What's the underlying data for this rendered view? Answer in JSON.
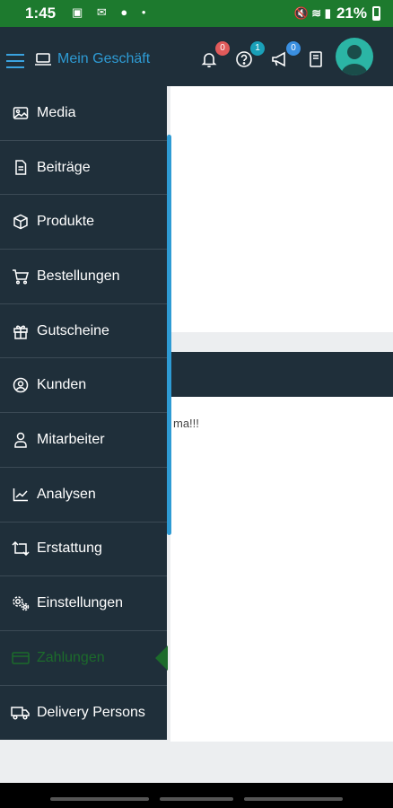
{
  "status_bar": {
    "time": "1:45",
    "battery": "21%"
  },
  "header": {
    "brand_label": "Mein Geschäft",
    "notifications_count": "0",
    "help_count": "1",
    "announcements_count": "0"
  },
  "background": {
    "text": "ma!!!"
  },
  "sidebar": {
    "items": [
      {
        "label": "Media",
        "icon": "image-icon"
      },
      {
        "label": "Beiträge",
        "icon": "document-icon"
      },
      {
        "label": "Produkte",
        "icon": "box-icon"
      },
      {
        "label": "Bestellungen",
        "icon": "cart-icon"
      },
      {
        "label": "Gutscheine",
        "icon": "gift-icon"
      },
      {
        "label": "Kunden",
        "icon": "user-circle-icon"
      },
      {
        "label": "Mitarbeiter",
        "icon": "user-icon"
      },
      {
        "label": "Analysen",
        "icon": "chart-line-icon"
      },
      {
        "label": "Erstattung",
        "icon": "refund-icon"
      },
      {
        "label": "Einstellungen",
        "icon": "settings-icon"
      },
      {
        "label": "Zahlungen",
        "icon": "credit-card-icon",
        "active": true
      },
      {
        "label": "Delivery Persons",
        "icon": "truck-icon"
      }
    ]
  },
  "colors": {
    "statusbar": "#1d7a2e",
    "header": "#1f2f3a",
    "accent_blue": "#2e9bd4",
    "active_green": "#1c6b2b",
    "badge_red": "#e05a5a",
    "badge_teal": "#1aa0b8",
    "badge_blue": "#3a8fe0"
  }
}
